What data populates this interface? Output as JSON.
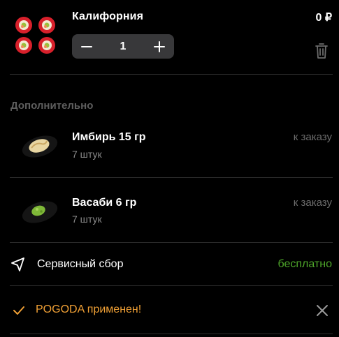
{
  "cart_item": {
    "name": "Калифорния",
    "price": "0 ₽",
    "quantity": "1",
    "image_icon": "sushi-rolls-icon"
  },
  "extras": {
    "title": "Дополнительно",
    "items": [
      {
        "name": "Имбирь 15 гр",
        "quantity": "7 штук",
        "status": "к заказу",
        "image_icon": "ginger-icon"
      },
      {
        "name": "Васаби 6 гр",
        "quantity": "7 штук",
        "status": "к заказу",
        "image_icon": "wasabi-icon"
      }
    ]
  },
  "service_fee": {
    "label": "Сервисный сбор",
    "value": "бесплатно",
    "icon": "navigation-arrow-icon",
    "value_color": "#4ea62a"
  },
  "promo": {
    "text": "POGODA применен!",
    "icon": "checkmark-icon",
    "color": "#f0a035"
  }
}
